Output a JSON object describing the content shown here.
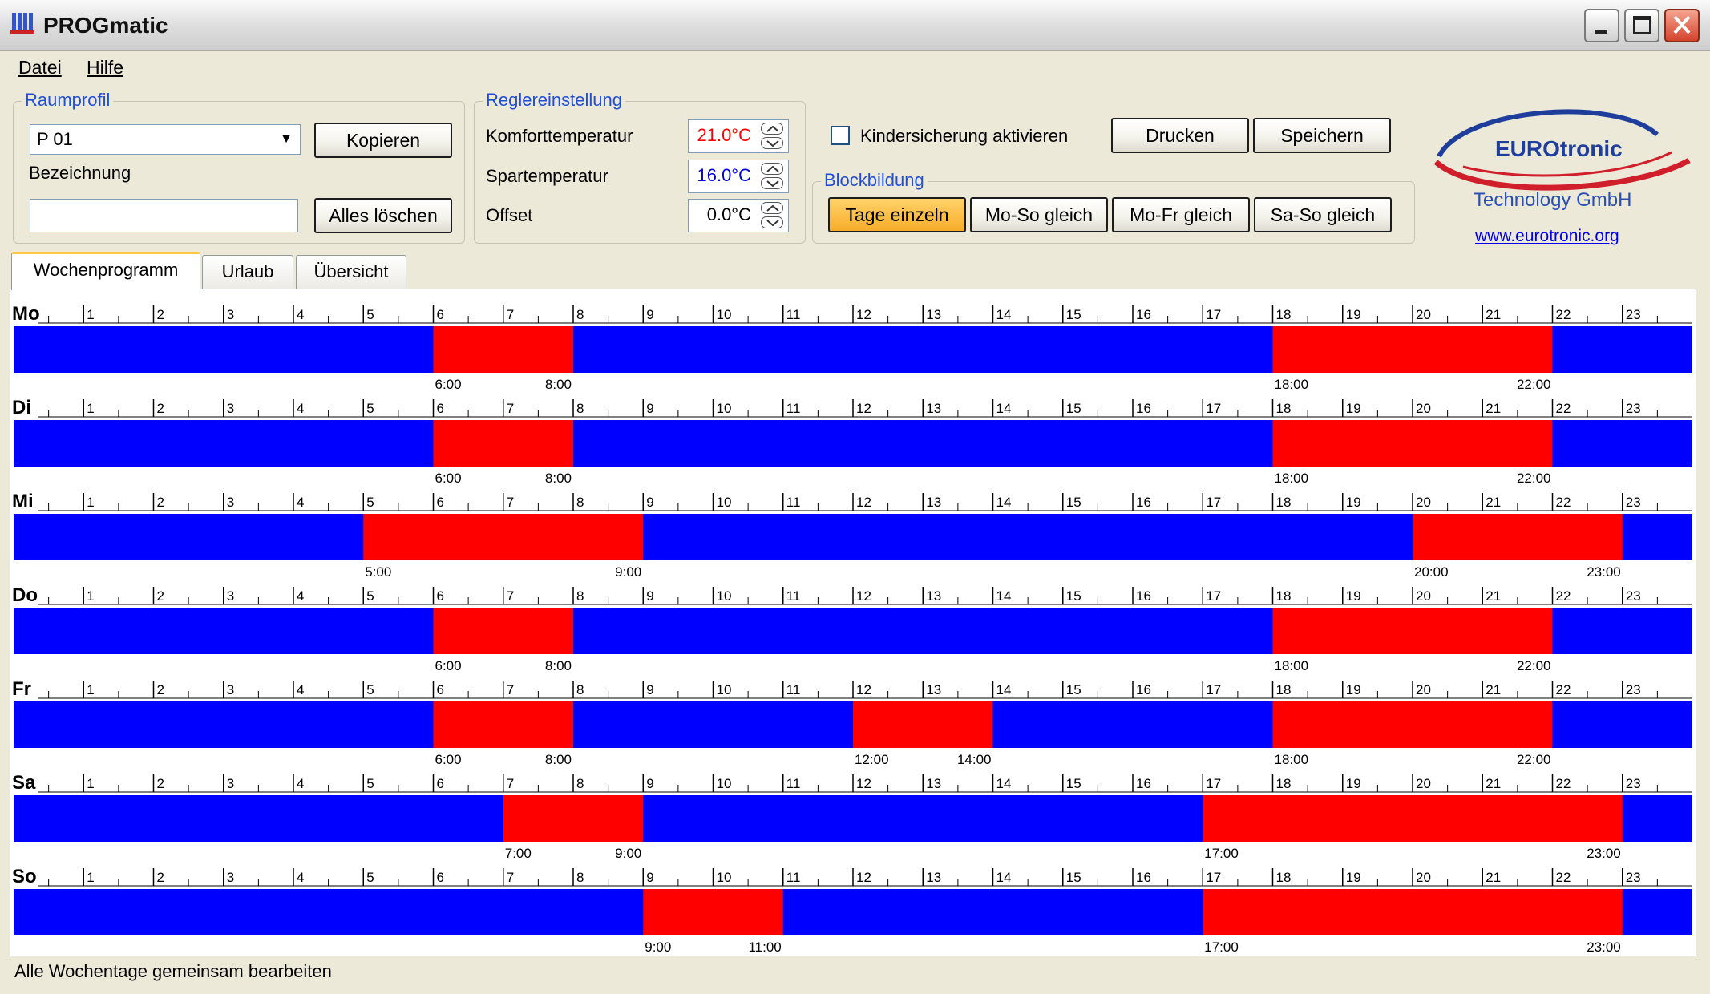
{
  "window": {
    "title": "PROGmatic"
  },
  "menu": {
    "items": [
      "Datei",
      "Hilfe"
    ]
  },
  "raumprofil": {
    "legend": "Raumprofil",
    "profile_value": "P 01",
    "copy_button": "Kopieren",
    "name_label": "Bezeichnung",
    "name_value": "",
    "clear_button": "Alles löschen"
  },
  "regler": {
    "legend": "Reglereinstellung",
    "comfort_label": "Komforttemperatur",
    "comfort_value": "21.0°C",
    "saving_label": "Spartemperatur",
    "saving_value": "16.0°C",
    "offset_label": "Offset",
    "offset_value": "0.0°C"
  },
  "kindersicherung": {
    "label": "Kindersicherung aktivieren",
    "checked": false
  },
  "actions": {
    "print": "Drucken",
    "save": "Speichern"
  },
  "blockbildung": {
    "legend": "Blockbildung",
    "buttons": [
      "Tage einzeln",
      "Mo-So gleich",
      "Mo-Fr gleich",
      "Sa-So gleich"
    ],
    "active_index": 0
  },
  "logo": {
    "brand": "EUROtronic",
    "subtitle": "Technology GmbH",
    "link": "www.eurotronic.org"
  },
  "tabs": {
    "items": [
      "Wochenprogramm",
      "Urlaub",
      "Übersicht"
    ],
    "active_index": 0
  },
  "chart_data": {
    "type": "timeline",
    "hours": [
      1,
      2,
      3,
      4,
      5,
      6,
      7,
      8,
      9,
      10,
      11,
      12,
      13,
      14,
      15,
      16,
      17,
      18,
      19,
      20,
      21,
      22,
      23
    ],
    "colors": {
      "comfort": "#ff0000",
      "saving": "#0000ff"
    },
    "days": [
      {
        "name": "Mo",
        "comfort": [
          [
            "6:00",
            "8:00"
          ],
          [
            "18:00",
            "22:00"
          ]
        ]
      },
      {
        "name": "Di",
        "comfort": [
          [
            "6:00",
            "8:00"
          ],
          [
            "18:00",
            "22:00"
          ]
        ]
      },
      {
        "name": "Mi",
        "comfort": [
          [
            "5:00",
            "9:00"
          ],
          [
            "20:00",
            "23:00"
          ]
        ]
      },
      {
        "name": "Do",
        "comfort": [
          [
            "6:00",
            "8:00"
          ],
          [
            "18:00",
            "22:00"
          ]
        ]
      },
      {
        "name": "Fr",
        "comfort": [
          [
            "6:00",
            "8:00"
          ],
          [
            "12:00",
            "14:00"
          ],
          [
            "18:00",
            "22:00"
          ]
        ]
      },
      {
        "name": "Sa",
        "comfort": [
          [
            "7:00",
            "9:00"
          ],
          [
            "17:00",
            "23:00"
          ]
        ]
      },
      {
        "name": "So",
        "comfort": [
          [
            "9:00",
            "11:00"
          ],
          [
            "17:00",
            "23:00"
          ]
        ]
      }
    ]
  },
  "status": {
    "text": "Alle Wochentage gemeinsam bearbeiten"
  }
}
